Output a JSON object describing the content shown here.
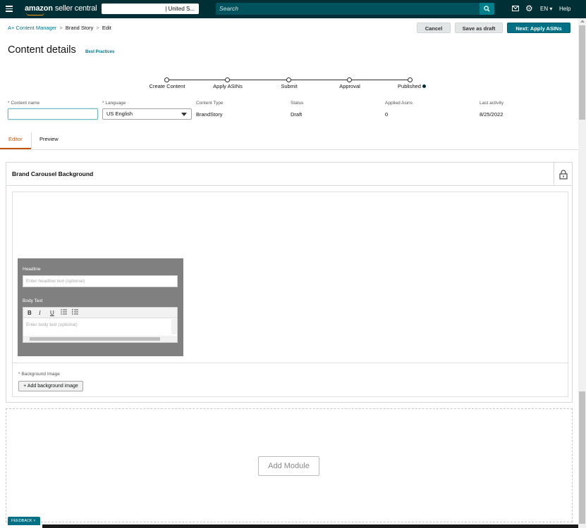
{
  "header": {
    "brand_bold": "amazon",
    "brand_rest": "seller central",
    "marketplace": "| United S...",
    "search_placeholder": "Search",
    "language": "EN",
    "help_label": "Help"
  },
  "breadcrumb": {
    "items": [
      "A+ Content Manager",
      "Brand Story",
      "Edit"
    ],
    "separator": ">"
  },
  "actions": {
    "cancel": "Cancel",
    "save_draft": "Save as draft",
    "next": "Next: Apply ASINs"
  },
  "page": {
    "title": "Content details",
    "best_practices": "Best Practices"
  },
  "stepper": {
    "steps": [
      "Create Content",
      "Apply ASINs",
      "Submit",
      "Approval",
      "Published"
    ]
  },
  "fields": {
    "content_name": {
      "label": "* Content name",
      "value": ""
    },
    "language": {
      "label": "* Language",
      "value": "US English"
    },
    "content_type": {
      "label": "Content Type",
      "value": "BrandStory"
    },
    "status": {
      "label": "Status",
      "value": "Draft"
    },
    "applied_asins": {
      "label": "Applied Asins",
      "value": "0"
    },
    "last_activity": {
      "label": "Last activity",
      "value": "8/25/2022"
    }
  },
  "tabs": {
    "editor": "Editor",
    "preview": "Preview"
  },
  "module": {
    "title": "Brand Carousel Background",
    "headline_label": "Headline",
    "headline_placeholder": "Enter headline text (optional)",
    "body_label": "Body Text",
    "body_placeholder": "Enter body text (optional)",
    "toolbar": {
      "bold": "B",
      "italic": "I",
      "underline": "U"
    },
    "background_image_label": "* Background Image",
    "add_background_button": "+ Add background image"
  },
  "add_module": "Add Module",
  "feedback": "FEEDBACK",
  "feedback_close": "×"
}
